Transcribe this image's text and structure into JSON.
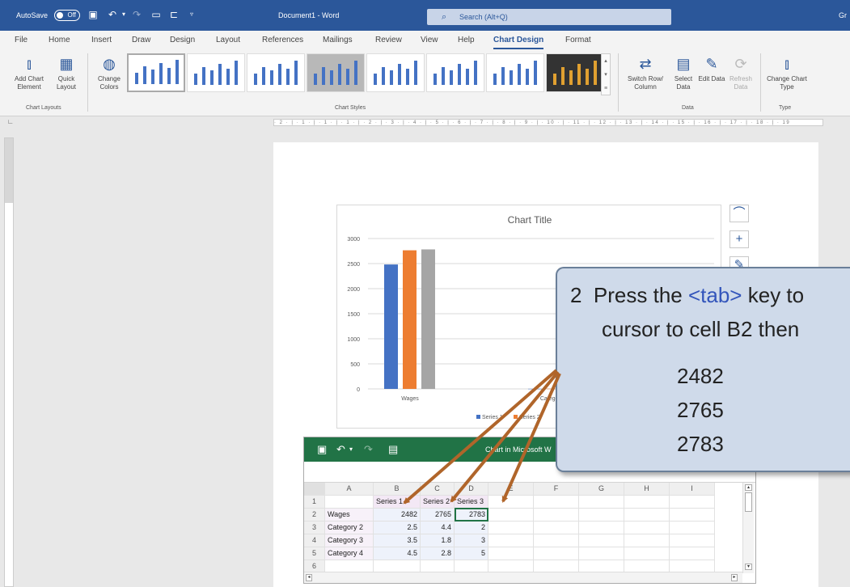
{
  "titlebar": {
    "autosave_label": "AutoSave",
    "autosave_state": "Off",
    "document_title": "Document1  -  Word",
    "search_placeholder": "Search (Alt+Q)",
    "user_initials": "Gr"
  },
  "ribbon_tabs": [
    "File",
    "Home",
    "Insert",
    "Draw",
    "Design",
    "Layout",
    "References",
    "Mailings",
    "Review",
    "View",
    "Help",
    "Chart Design",
    "Format"
  ],
  "ribbon": {
    "add_chart_element": "Add Chart Element",
    "quick_layout": "Quick Layout",
    "change_colors": "Change Colors",
    "group_chart_layouts": "Chart Layouts",
    "group_chart_styles": "Chart Styles",
    "switch_row_column": "Switch Row/ Column",
    "select_data": "Select Data",
    "edit_data": "Edit Data",
    "refresh_data": "Refresh Data",
    "group_data": "Data",
    "change_chart_type": "Change Chart Type",
    "group_type": "Type"
  },
  "ruler_text": "· 2 · | · 1 · | · 1 · | · 1 · | · 2 · | · 3 · | · 4 · | · 5 · | · 6 · | · 7 · | · 8 · | · 9 · | · 10 · | · 11 · | · 12 · | · 13 · | · 14 · | · 15 · | · 16 · | · 17 · | · 18 · | · 19",
  "chart_data": {
    "type": "bar",
    "title": "Chart Title",
    "categories": [
      "Wages",
      "Category 2"
    ],
    "series": [
      {
        "name": "Series 1",
        "values": [
          2482,
          2.5
        ],
        "color": "#4472c4"
      },
      {
        "name": "Series 2",
        "values": [
          2765,
          4.4
        ],
        "color": "#ed7d31"
      },
      {
        "name": "Series 3",
        "values": [
          2783,
          2
        ],
        "color": "#a5a5a5"
      }
    ],
    "ylim": [
      0,
      3000
    ],
    "yticks": [
      0,
      500,
      1000,
      1500,
      2000,
      2500,
      3000
    ],
    "grid": true,
    "legend": "bottom",
    "legend_visible": [
      "Series 1",
      "Series 2"
    ]
  },
  "sheet": {
    "title": "Chart in Microsoft W",
    "columns": [
      "A",
      "B",
      "C",
      "D",
      "E",
      "F",
      "G",
      "H",
      "I"
    ],
    "rows": [
      {
        "num": "1",
        "cells": [
          "",
          "Series 1",
          "Series 2",
          "Series 3"
        ]
      },
      {
        "num": "2",
        "cells": [
          "Wages",
          "2482",
          "2765",
          "2783"
        ]
      },
      {
        "num": "3",
        "cells": [
          "Category 2",
          "2.5",
          "4.4",
          "2"
        ]
      },
      {
        "num": "4",
        "cells": [
          "Category 3",
          "3.5",
          "1.8",
          "3"
        ]
      },
      {
        "num": "5",
        "cells": [
          "Category 4",
          "4.5",
          "2.8",
          "5"
        ]
      },
      {
        "num": "6",
        "cells": [
          "",
          "",
          "",
          ""
        ]
      }
    ]
  },
  "callout": {
    "step_number": "2",
    "text_part1": "Press the",
    "key_text": "<tab>",
    "text_part2": "key to",
    "line2": "cursor to cell B2 then",
    "values": [
      "2482",
      "2765",
      "2783"
    ]
  },
  "colors": {
    "word_blue": "#2b579a",
    "excel_green": "#217346",
    "arrow": "#b0652a",
    "callout_bg": "#cfdaea"
  }
}
